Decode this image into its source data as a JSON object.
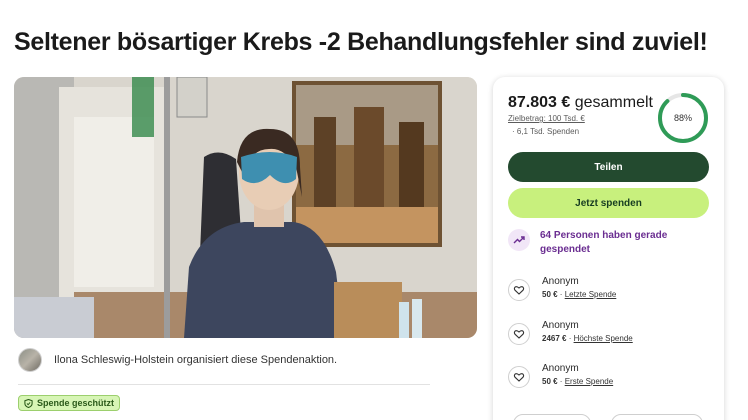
{
  "page": {
    "title": "Seltener bösartiger Krebs -2 Behandlungsfehler sind zuviel!"
  },
  "organizer": {
    "text": "Ilona Schleswig-Holstein organisiert diese Spendenaktion."
  },
  "badge": {
    "label": "Spende geschützt"
  },
  "donation": {
    "raised_amount": "87.803 €",
    "raised_suffix": " gesammelt",
    "goal": "Zielbetrag: 100 Tsd. €",
    "count": "· 6,1 Tsd. Spenden",
    "progress_percent": 88,
    "progress_label": "88%",
    "share_label": "Teilen",
    "donate_label": "Jetzt spenden",
    "trending": "64 Personen haben gerade gespendet"
  },
  "donors": [
    {
      "name": "Anonym",
      "amount": "50 €",
      "sep": " · ",
      "tag": "Letzte Spende"
    },
    {
      "name": "Anonym",
      "amount": "2467 €",
      "sep": " · ",
      "tag": "Höchste Spende"
    },
    {
      "name": "Anonym",
      "amount": "50 €",
      "sep": " · ",
      "tag": "Erste Spende"
    }
  ],
  "colors": {
    "share_bg": "#234a2f",
    "donate_bg": "#c8f07d",
    "progress": "#2f9b57",
    "trending": "#6a2d91"
  }
}
